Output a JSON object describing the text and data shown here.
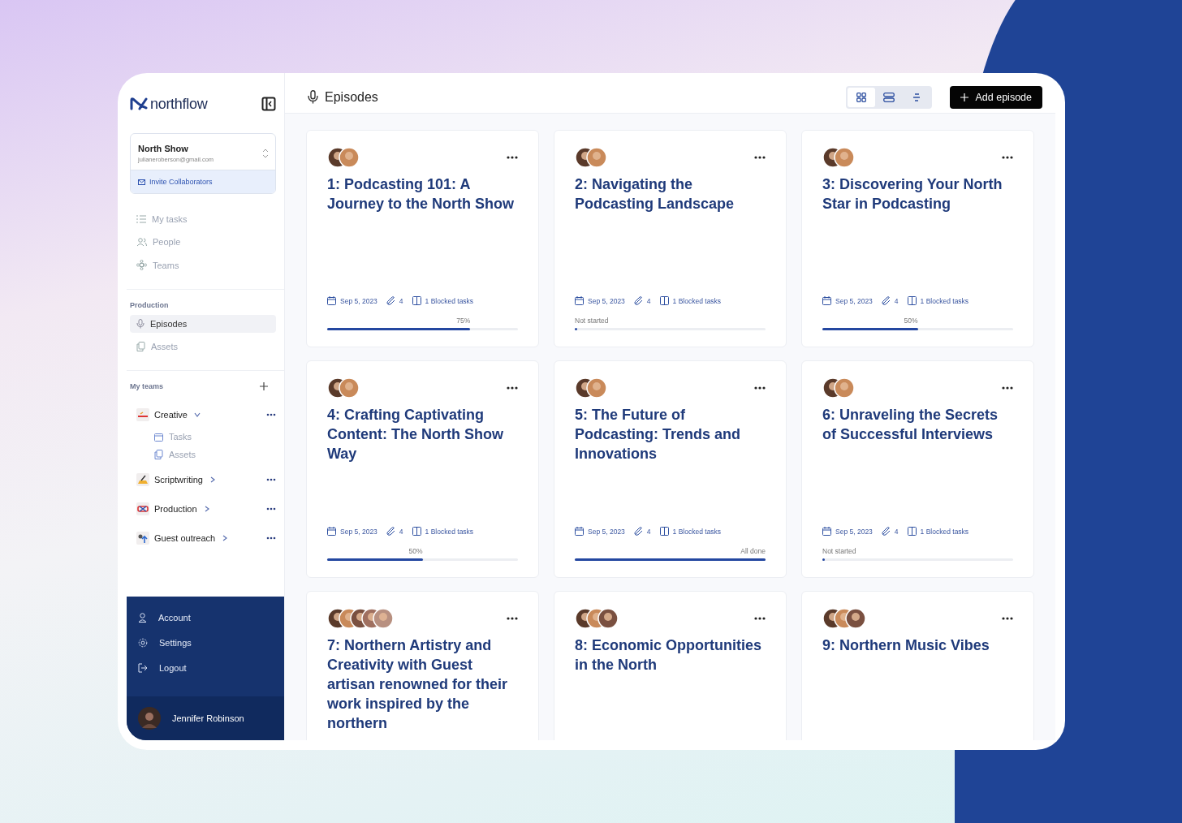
{
  "sidebar": {
    "logo": "**north**flow",
    "workspace": {
      "name": "North Show",
      "email": "julianeroberson@gmail.com",
      "invite": "Invite Collaborators"
    },
    "nav": [
      {
        "label": "My tasks",
        "selected": false
      },
      {
        "label": "People",
        "selected": false
      },
      {
        "label": "Teams",
        "selected": false
      }
    ],
    "section": "Production",
    "section_items": [
      {
        "label": "Episodes",
        "selected": true
      },
      {
        "label": "Assets",
        "selected": false
      }
    ],
    "teams_title": "My teams",
    "teams": [
      {
        "label": "Creative",
        "expanded": true,
        "children": [
          {
            "label": "Tasks"
          },
          {
            "label": "Assets"
          }
        ]
      },
      {
        "label": "Scriptwriting",
        "expanded": false
      },
      {
        "label": "Production",
        "expanded": false
      },
      {
        "label": "Guest outreach",
        "expanded": false
      }
    ],
    "bottom": [
      {
        "label": "Account"
      },
      {
        "label": "Settings"
      },
      {
        "label": "Logout"
      }
    ],
    "user": "Jennifer Robinson"
  },
  "header": {
    "title": "Episodes",
    "views": [
      {
        "selected": true
      },
      {
        "selected": false
      },
      {
        "selected": false
      }
    ],
    "add_button": "Add episode"
  },
  "episodes": [
    {
      "title": "1: Podcasting 101: A Journey to the North Show",
      "avatars": [
        {
          "kind": "photo"
        },
        {
          "kind": "photo"
        }
      ],
      "date": "Sep 5, 2023",
      "attachments": "4",
      "blocked": "1 Blocked tasks",
      "progress_label": "75%",
      "level": 0.75
    },
    {
      "title": "2: Navigating the Podcasting Landscape",
      "avatars": [
        {
          "kind": "photo"
        },
        {
          "kind": "photo"
        }
      ],
      "date": "Sep 5, 2023",
      "attachments": "4",
      "blocked": "1 Blocked tasks",
      "progress_label": "Not started",
      "level": 0
    },
    {
      "title": "3: Discovering Your North Star in Podcasting",
      "avatars": [
        {
          "kind": "photo"
        },
        {
          "kind": "photo"
        }
      ],
      "date": "Sep 5, 2023",
      "attachments": "4",
      "blocked": "1 Blocked tasks",
      "progress_label": "50%",
      "level": 0.5
    },
    {
      "title": "4: Crafting Captivating Content: The North Show Way",
      "avatars": [
        {
          "kind": "photo"
        },
        {
          "kind": "photo"
        }
      ],
      "date": "Sep 5, 2023",
      "attachments": "4",
      "blocked": "1 Blocked tasks",
      "progress_label": "50%",
      "level": 0.5
    },
    {
      "title": "5: The Future of Podcasting: Trends and Innovations",
      "avatars": [
        {
          "kind": "photo"
        },
        {
          "kind": "photo"
        }
      ],
      "date": "Sep 5, 2023",
      "attachments": "4",
      "blocked": "1 Blocked tasks",
      "progress_label": "All done",
      "level": 1
    },
    {
      "title": "6: Unraveling the Secrets of Successful Interviews",
      "avatars": [
        {
          "kind": "photo"
        },
        {
          "kind": "photo"
        }
      ],
      "date": "Sep 5, 2023",
      "attachments": "4",
      "blocked": "1 Blocked tasks",
      "progress_label": "Not started",
      "level": 0
    },
    {
      "title": "7: Northern Artistry and Creativity with Guest artisan renowned for their work inspired by the northern",
      "avatars": [
        {
          "kind": "photo"
        },
        {
          "kind": "photo"
        },
        {
          "kind": "photo"
        },
        {
          "kind": "photo"
        },
        {
          "kind": "photo"
        }
      ]
    },
    {
      "title": "8: Economic Opportunities in the North",
      "avatars": [
        {
          "kind": "photo"
        },
        {
          "kind": "photo"
        },
        {
          "kind": "photo"
        }
      ]
    },
    {
      "title": "9: Northern Music Vibes",
      "avatars": [
        {
          "kind": "photo"
        },
        {
          "kind": "photo"
        },
        {
          "kind": "photo"
        }
      ]
    }
  ]
}
